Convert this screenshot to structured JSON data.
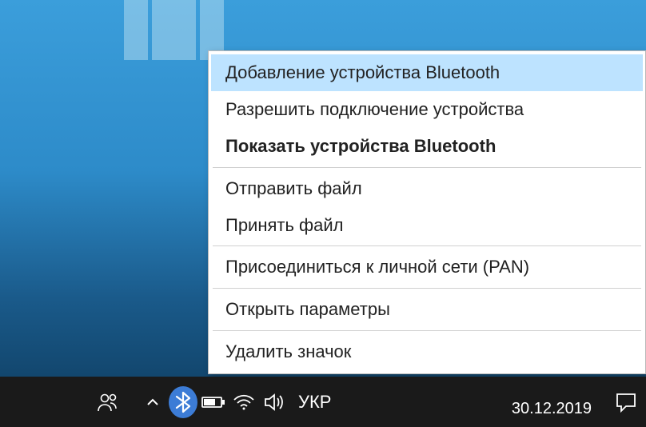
{
  "menu": {
    "items": [
      {
        "label": "Добавление устройства Bluetooth",
        "highlighted": true,
        "bold": false
      },
      {
        "label": "Разрешить подключение устройства",
        "highlighted": false,
        "bold": false
      },
      {
        "label": "Показать устройства Bluetooth",
        "highlighted": false,
        "bold": true
      }
    ],
    "group2": [
      {
        "label": "Отправить файл"
      },
      {
        "label": "Принять файл"
      }
    ],
    "group3": [
      {
        "label": "Присоединиться к личной сети (PAN)"
      }
    ],
    "group4": [
      {
        "label": "Открыть параметры"
      }
    ],
    "group5": [
      {
        "label": "Удалить значок"
      }
    ]
  },
  "taskbar": {
    "language": "УКР",
    "date": "30.12.2019"
  },
  "colors": {
    "highlight": "#bde3ff",
    "bluetooth": "#3c7cd6",
    "taskbar": "#1a1a1a"
  }
}
